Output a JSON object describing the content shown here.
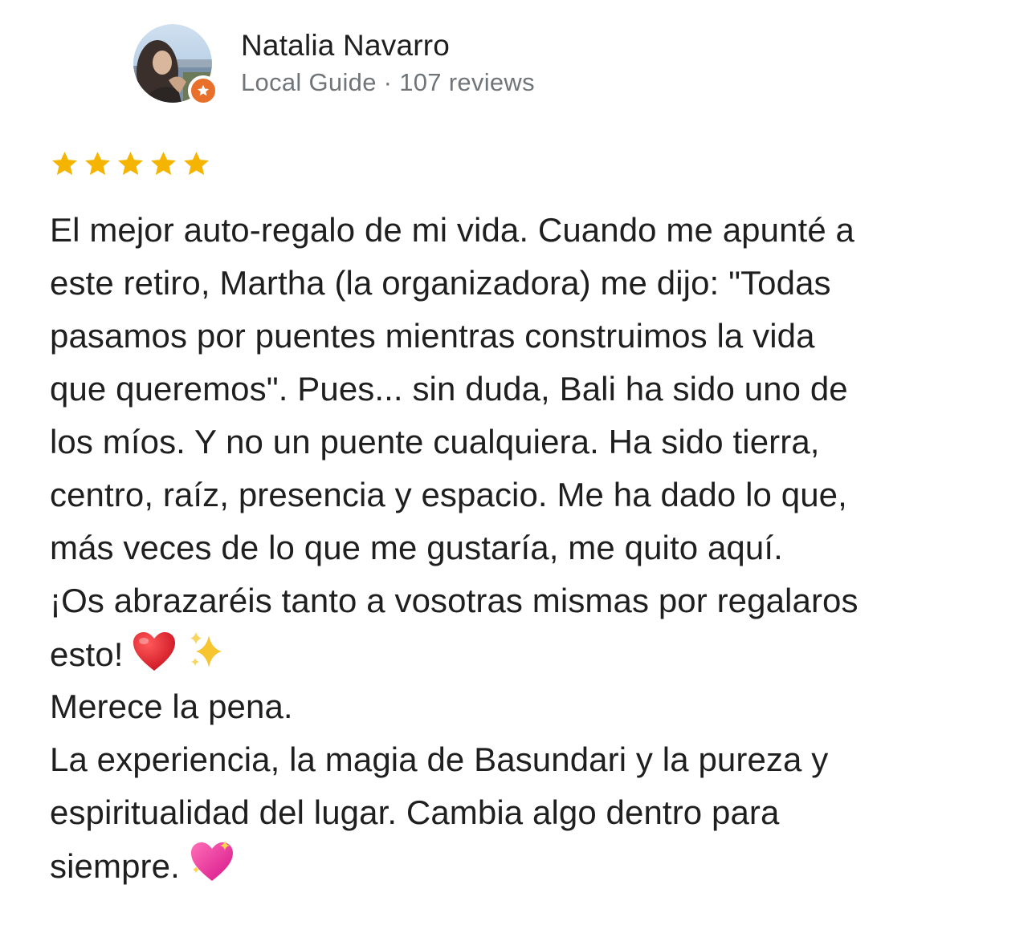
{
  "reviewer": {
    "name": "Natalia Navarro",
    "meta": "Local Guide · 107 reviews",
    "badge_icon": "local-guide-star-badge",
    "badge_color": "#e8702a"
  },
  "rating": {
    "stars": 5,
    "max": 5,
    "star_color": "#f4b400"
  },
  "review": {
    "lines": [
      "El mejor auto-regalo de mi vida. Cuando me apunté a",
      "este retiro, Martha (la organizadora) me dijo: \"Todas",
      "pasamos por puentes mientras construimos la vida",
      "que queremos\". Pues... sin duda, Bali ha sido uno de",
      "los míos. Y no un puente cualquiera. Ha sido tierra,",
      "centro, raíz, presencia y espacio. Me ha dado lo que,",
      "más veces de lo que me gustaría, me quito aquí.",
      "¡Os abrazaréis tanto a vosotras mismas por regalaros",
      "esto!",
      "Merece la pena.",
      "La experiencia, la magia de Basundari y la pureza y",
      "espiritualidad del lugar. Cambia algo dentro para",
      "siempre."
    ],
    "emojis": {
      "line9": [
        "red-heart-icon",
        "sparkles-icon"
      ],
      "line13": [
        "sparkling-heart-icon"
      ]
    }
  }
}
